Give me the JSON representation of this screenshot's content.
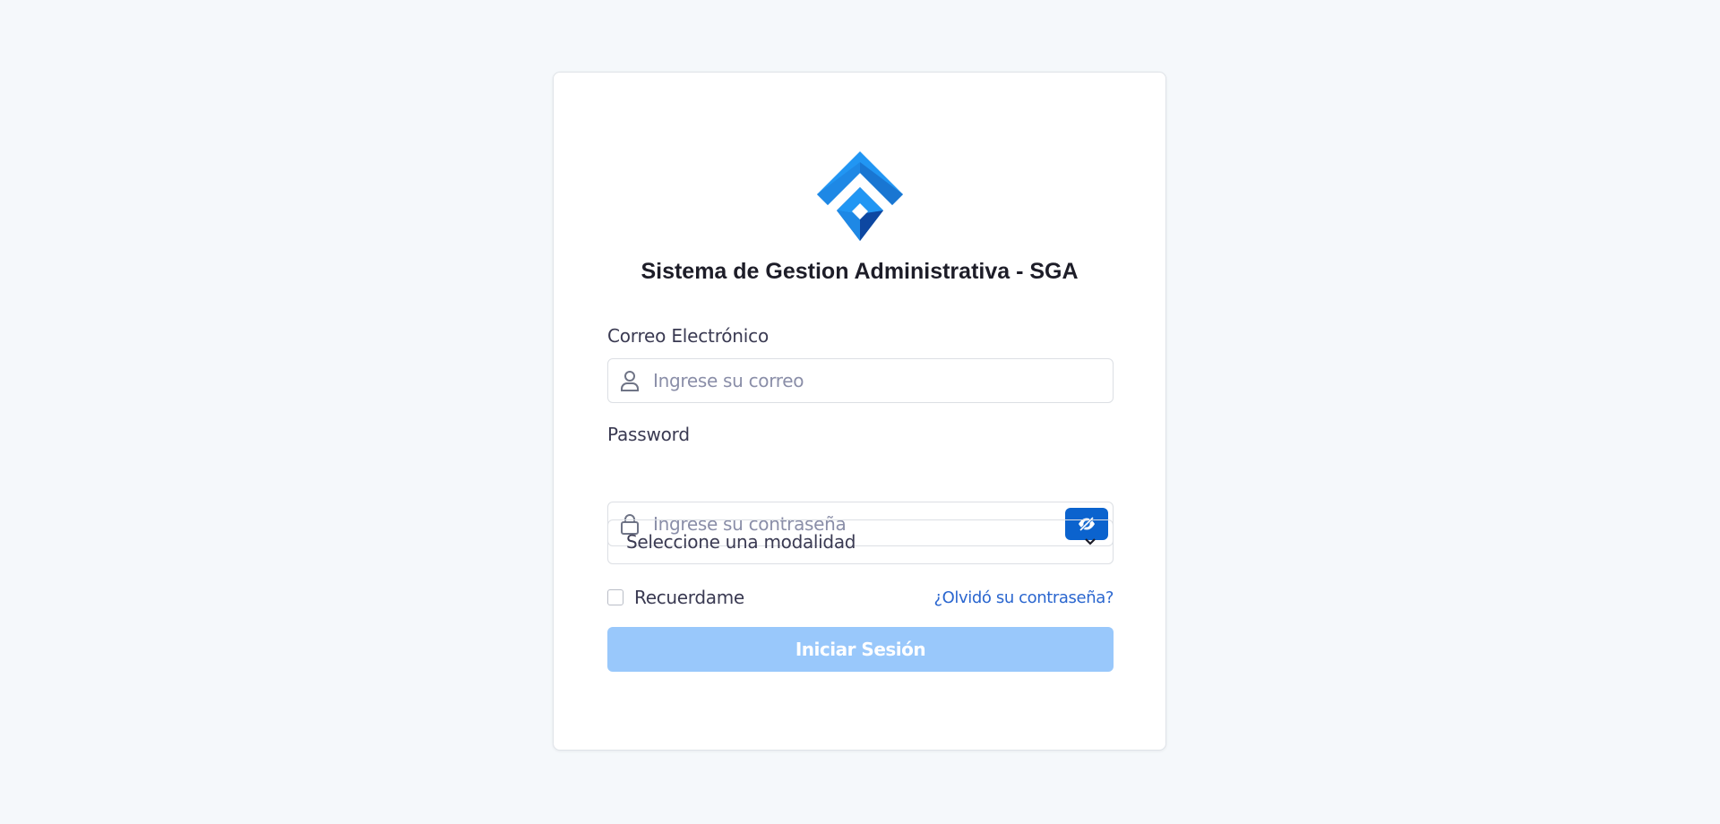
{
  "app": {
    "title": "Sistema de Gestion Administrativa - SGA"
  },
  "email": {
    "label": "Correo Electrónico",
    "placeholder": "Ingrese su correo",
    "value": "",
    "icon": "user-icon"
  },
  "password": {
    "label": "Password",
    "placeholder": "Ingrese su contraseña",
    "value": "",
    "icon": "lock-icon",
    "toggle_icon": "eye-slash-icon"
  },
  "modalidad": {
    "selected": "Seleccione una modalidad",
    "icon": "chevron-down-icon"
  },
  "remember": {
    "label": "Recuerdame",
    "checked": false
  },
  "forgot": {
    "label": "¿Olvidó su contraseña?"
  },
  "submit": {
    "label": "Iniciar Sesión"
  },
  "colors": {
    "page_bg": "#f5f8fb",
    "primary": "#0b63ce",
    "button_disabled": "#99c8fb",
    "link": "#2a66cf",
    "logo_light": "#2196f3",
    "logo_dark": "#1565c0"
  }
}
